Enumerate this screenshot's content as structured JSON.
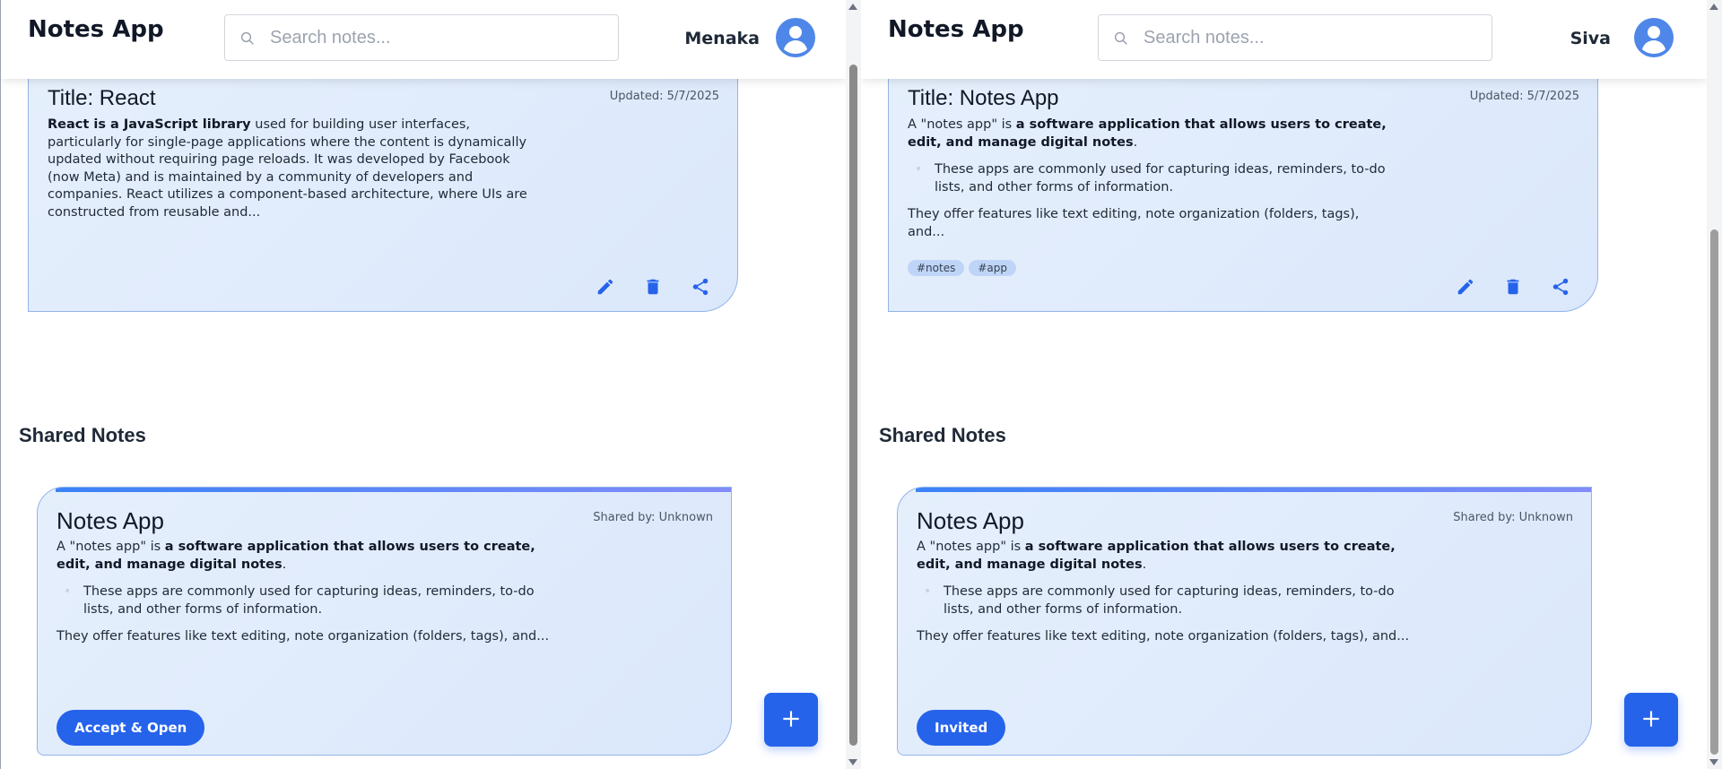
{
  "colors": {
    "accent": "#2563eb",
    "card_bg": "#e3edfc",
    "avatar": "#4f87e9"
  },
  "left": {
    "header": {
      "brand": "Notes App",
      "search_placeholder": "Search notes...",
      "username": "Menaka",
      "avatar_icon": "user-icon"
    },
    "note": {
      "title": "Title: React",
      "updated": "Updated: 5/7/2025",
      "body_bold": "React is a JavaScript library",
      "body_rest": " used for building user interfaces, particularly for single-page applications where the content is dynamically updated without requiring page reloads. It was developed by Facebook (now Meta) and is maintained by a community of developers and companies. React utilizes a component-based architecture, where UIs are constructed from reusable and..."
    },
    "shared_section_title": "Shared Notes",
    "shared": {
      "title": "Notes App",
      "shared_by": "Shared by: Unknown",
      "intro_plain": "A \"notes app\" is ",
      "intro_bold": "a software application that allows users to create, edit, and manage digital notes",
      "intro_end": ".",
      "bullet": "These apps are commonly used for capturing ideas, reminders, to-do lists, and other forms of information.",
      "outro": "They offer features like text editing, note organization (folders, tags), and...",
      "button": "Accept & Open"
    },
    "fab_icon": "plus-icon"
  },
  "right": {
    "header": {
      "brand": "Notes App",
      "search_placeholder": "Search notes...",
      "username": "Siva",
      "avatar_icon": "user-icon"
    },
    "note": {
      "title": "Title: Notes App",
      "updated": "Updated: 5/7/2025",
      "intro_plain": "A \"notes app\" is ",
      "intro_bold": "a software application that allows users to create, edit, and manage digital notes",
      "intro_end": ".",
      "bullet": "These apps are commonly used for capturing ideas, reminders, to-do lists, and other forms of information.",
      "outro": "They offer features like text editing, note organization (folders, tags), and...",
      "tags": [
        "#notes",
        "#app"
      ]
    },
    "shared_section_title": "Shared Notes",
    "shared": {
      "title": "Notes App",
      "shared_by": "Shared by: Unknown",
      "intro_plain": "A \"notes app\" is ",
      "intro_bold": "a software application that allows users to create, edit, and manage digital notes",
      "intro_end": ".",
      "bullet": "These apps are commonly used for capturing ideas, reminders, to-do lists, and other forms of information.",
      "outro": "They offer features like text editing, note organization (folders, tags), and...",
      "button": "Invited"
    },
    "fab_icon": "plus-icon"
  }
}
